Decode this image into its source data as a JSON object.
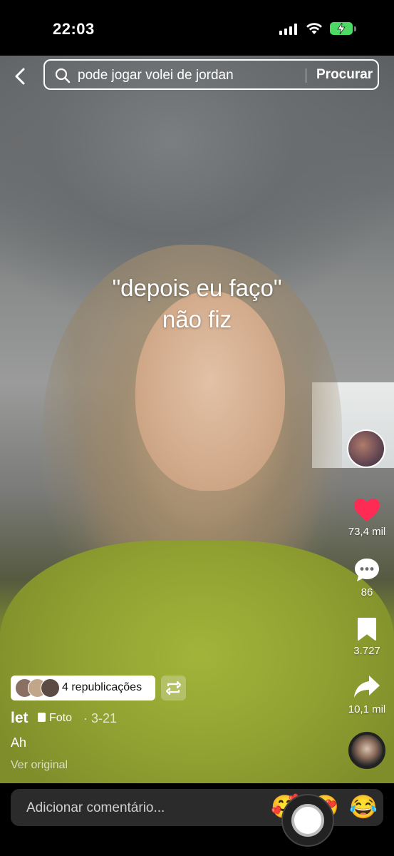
{
  "status_bar": {
    "time": "22:03"
  },
  "search": {
    "query": "pode jogar volei de jordan",
    "button": "Procurar"
  },
  "caption": {
    "line1": "\"depois eu faço\"",
    "line2": "não fiz"
  },
  "rail": {
    "likes": "73,4 mil",
    "comments": "86",
    "saves": "3.727",
    "shares": "10,1 mil"
  },
  "post": {
    "reposts": "4 republicações",
    "username": "let",
    "type_label": "Foto",
    "date": "· 3-21",
    "description": "Ah",
    "view_original": "Ver original"
  },
  "comment_bar": {
    "placeholder": "Adicionar comentário...",
    "emojis": [
      "🥰",
      "😍",
      "😂"
    ]
  },
  "colors": {
    "like": "#fe2c55",
    "battery": "#4cd964"
  }
}
